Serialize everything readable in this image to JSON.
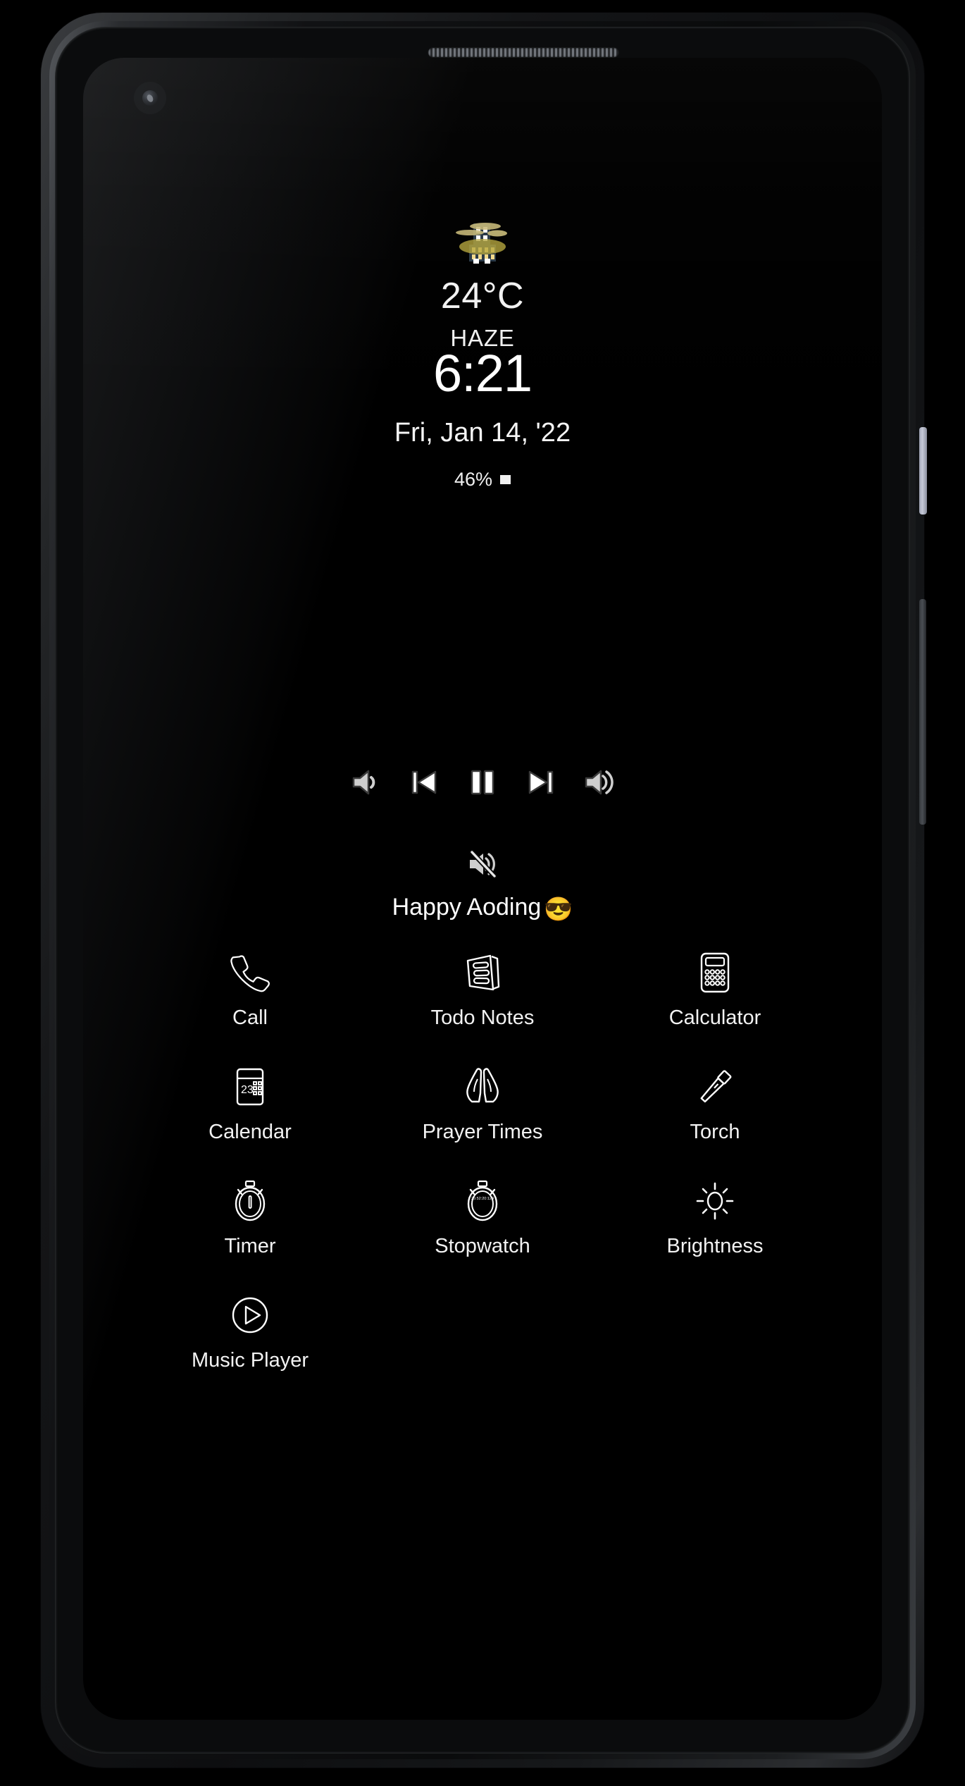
{
  "device": {
    "name": "android-phone",
    "hardware": {
      "earpiece": "earpiece-speaker",
      "front_camera": "punch-hole-camera",
      "power_button": "power-button",
      "volume_rocker": "volume-rocker"
    }
  },
  "screen": {
    "background_color": "#000000",
    "text_color": "#ffffff"
  },
  "weather": {
    "icon": "foggy-buildings-icon",
    "temperature": "24°C",
    "condition": "HAZE"
  },
  "clock": {
    "time": "6:21",
    "date": "Fri, Jan 14, '22"
  },
  "battery": {
    "percent": "46%",
    "icon": "battery-low-icon"
  },
  "media_controls": [
    {
      "name": "volume-down-button",
      "icon": "volume-down-icon",
      "label": "Volume Down"
    },
    {
      "name": "previous-track-button",
      "icon": "skip-previous-icon",
      "label": "Previous"
    },
    {
      "name": "pause-button",
      "icon": "pause-icon",
      "label": "Pause"
    },
    {
      "name": "next-track-button",
      "icon": "skip-next-icon",
      "label": "Next"
    },
    {
      "name": "volume-up-button",
      "icon": "volume-up-icon",
      "label": "Volume Up"
    }
  ],
  "mute": {
    "name": "mute-button",
    "icon": "volume-mute-icon",
    "label": "Mute"
  },
  "greeting": {
    "text": "Happy Aoding",
    "emoji": "😎"
  },
  "apps": [
    {
      "label": "Call",
      "icon": "phone-icon"
    },
    {
      "label": "Todo Notes",
      "icon": "notes-icon"
    },
    {
      "label": "Calculator",
      "icon": "calculator-icon"
    },
    {
      "label": "Calendar",
      "icon": "calendar-icon",
      "day": "23"
    },
    {
      "label": "Prayer Times",
      "icon": "praying-hands-icon"
    },
    {
      "label": "Torch",
      "icon": "flashlight-icon"
    },
    {
      "label": "Timer",
      "icon": "timer-icon"
    },
    {
      "label": "Stopwatch",
      "icon": "stopwatch-icon"
    },
    {
      "label": "Brightness",
      "icon": "sun-icon"
    },
    {
      "label": "Music Player",
      "icon": "play-circle-icon"
    }
  ]
}
